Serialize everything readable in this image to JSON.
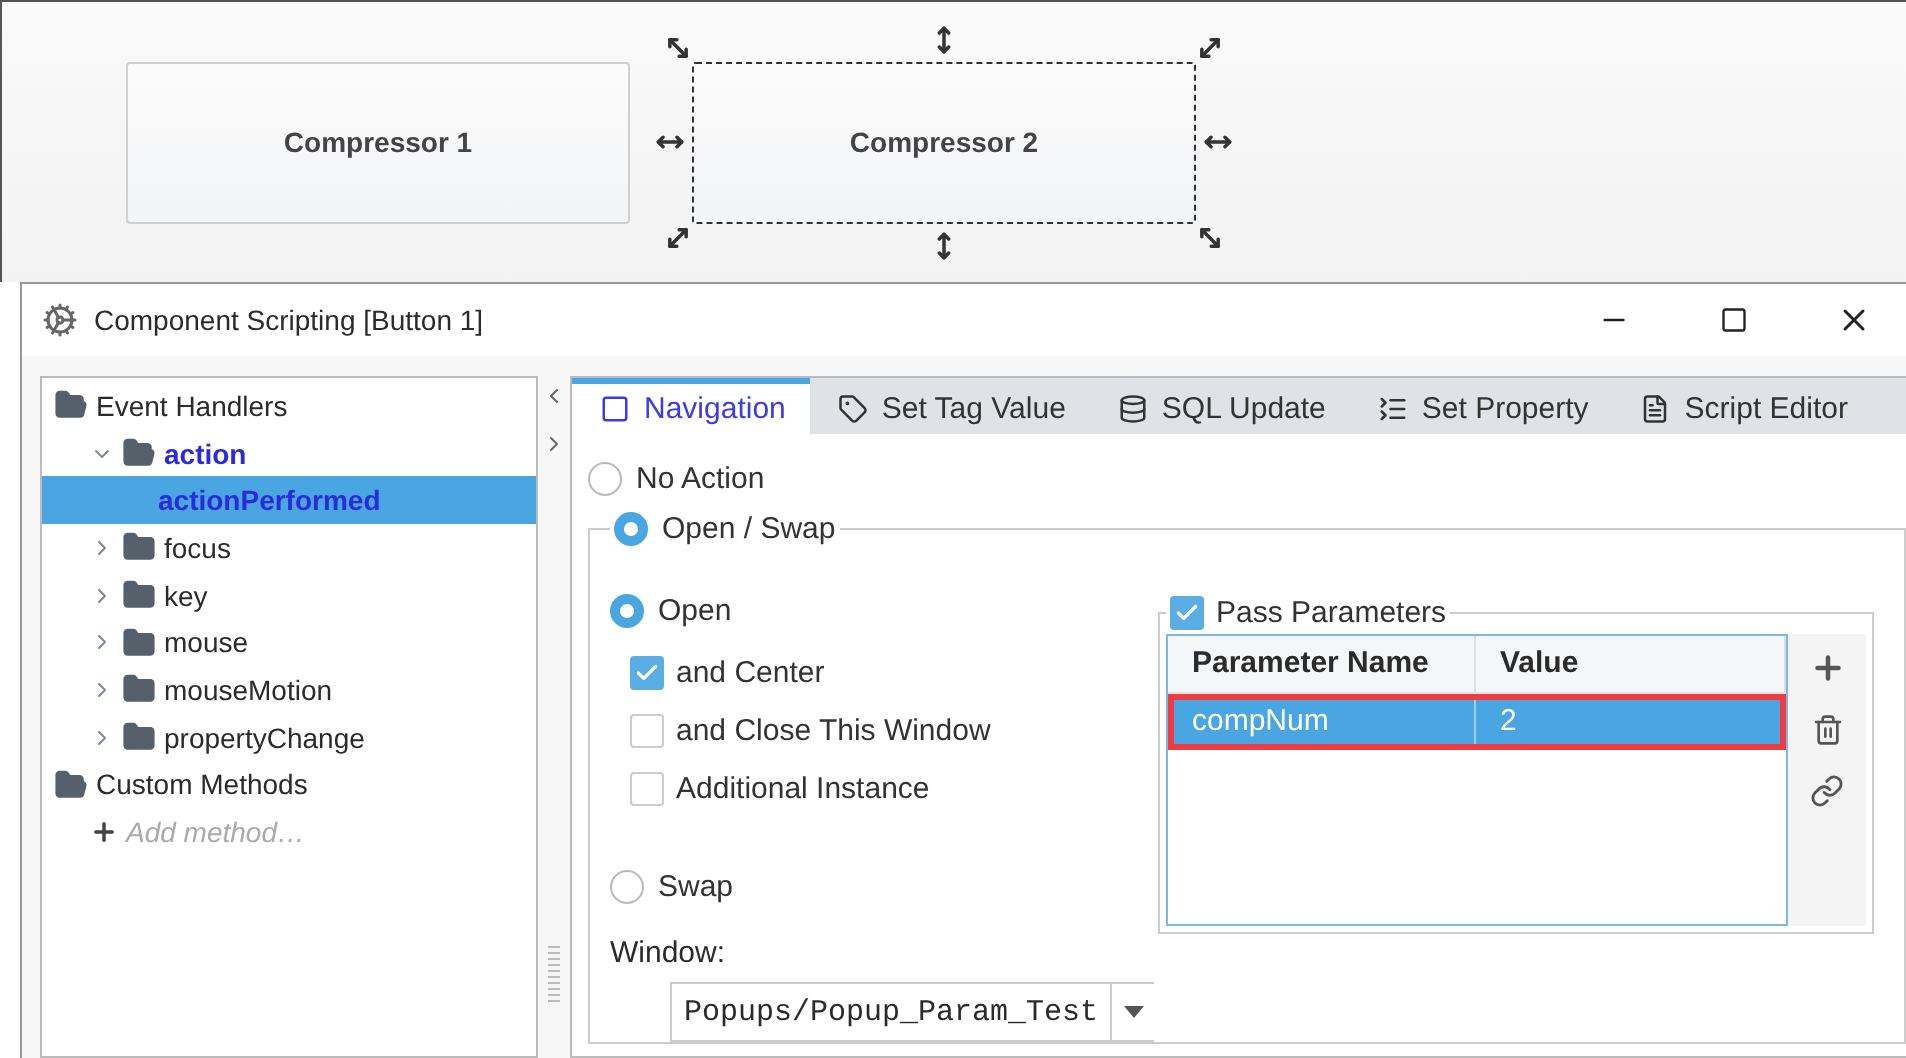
{
  "canvas": {
    "components": [
      {
        "label": "Compressor 1",
        "selected": false
      },
      {
        "label": "Compressor 2",
        "selected": true
      }
    ]
  },
  "dialog": {
    "title": "Component Scripting [Button 1]",
    "tree": [
      {
        "label": "Event Handlers",
        "selected": false,
        "children": [
          {
            "label": "action",
            "selected": false,
            "expanded": true,
            "configured": true,
            "children": [
              {
                "label": "actionPerformed",
                "selected": true,
                "configured": true
              }
            ]
          },
          {
            "label": "focus",
            "selected": false,
            "expanded": false,
            "configured": false
          },
          {
            "label": "key",
            "selected": false,
            "expanded": false,
            "configured": false
          },
          {
            "label": "mouse",
            "selected": false,
            "expanded": false,
            "configured": false
          },
          {
            "label": "mouseMotion",
            "selected": false,
            "expanded": false,
            "configured": false
          },
          {
            "label": "propertyChange",
            "selected": false,
            "expanded": false,
            "configured": false
          }
        ]
      },
      {
        "label": "Custom Methods",
        "selected": false,
        "children": [
          {
            "label": "Add method…",
            "kind": "add",
            "selected": false
          }
        ]
      }
    ],
    "tabs": [
      {
        "label": "Navigation",
        "kind": "navigation",
        "selected": true
      },
      {
        "label": "Set Tag Value",
        "kind": "tag",
        "selected": false
      },
      {
        "label": "SQL Update",
        "kind": "sql",
        "selected": false
      },
      {
        "label": "Set Property",
        "kind": "property",
        "selected": false
      },
      {
        "label": "Script Editor",
        "kind": "script",
        "selected": false
      }
    ],
    "no_action": {
      "label": "No Action",
      "selected": false
    },
    "open_swap": {
      "label": "Open / Swap",
      "selected": true,
      "modes": [
        {
          "label": "Open",
          "selected": true
        },
        {
          "label": "Swap",
          "selected": false
        }
      ],
      "options": [
        {
          "label": "and Center",
          "checked": true
        },
        {
          "label": "and Close This Window",
          "checked": false
        },
        {
          "label": "Additional Instance",
          "checked": false
        }
      ],
      "window": {
        "label": "Window:",
        "value": "Popups/Popup_Param_Test"
      },
      "pass_parameters": {
        "label": "Pass Parameters",
        "checked": true,
        "columns": [
          "Parameter Name",
          "Value"
        ],
        "rows": [
          {
            "cells": [
              "compNum",
              "2"
            ],
            "selected": true,
            "outlined": true
          }
        ]
      }
    }
  }
}
